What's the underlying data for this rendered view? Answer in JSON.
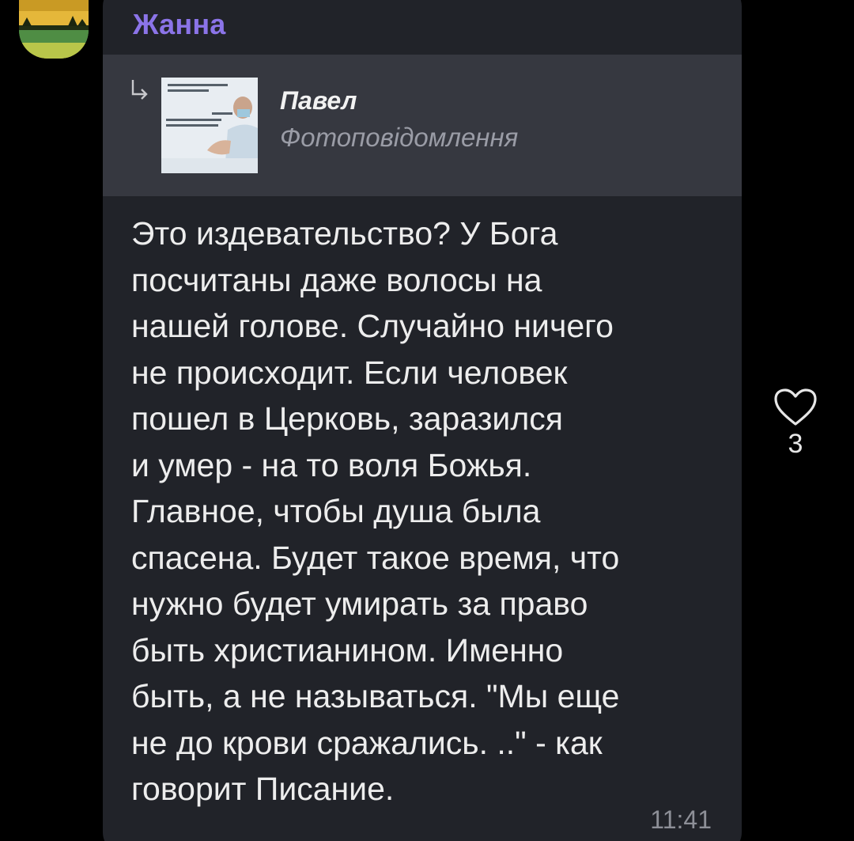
{
  "message": {
    "sender_name": "Жанна",
    "reply": {
      "author": "Павел",
      "subtitle": "Фотоповідомлення"
    },
    "text": "Это издевательство? У Бога\nпосчитаны даже волосы на\nнашей голове. Случайно ничего\nне происходит. Если человек\nпошел в Церковь, заразился\nи умер - на то воля Божья.\nГлавное, чтобы душа была\nспасена. Будет такое время, что\nнужно будет умирать за право\nбыть христианином. Именно\nбыть, а не называться. \"Мы еще\nне до крови сражались. ..\" - как\nговорит Писание.",
    "time": "11:41"
  },
  "reaction": {
    "icon": "heart-outline-icon",
    "count": "3"
  },
  "colors": {
    "background": "#000000",
    "bubble": "#212329",
    "reply_panel": "#363840",
    "sender_accent": "#8b74e8"
  }
}
